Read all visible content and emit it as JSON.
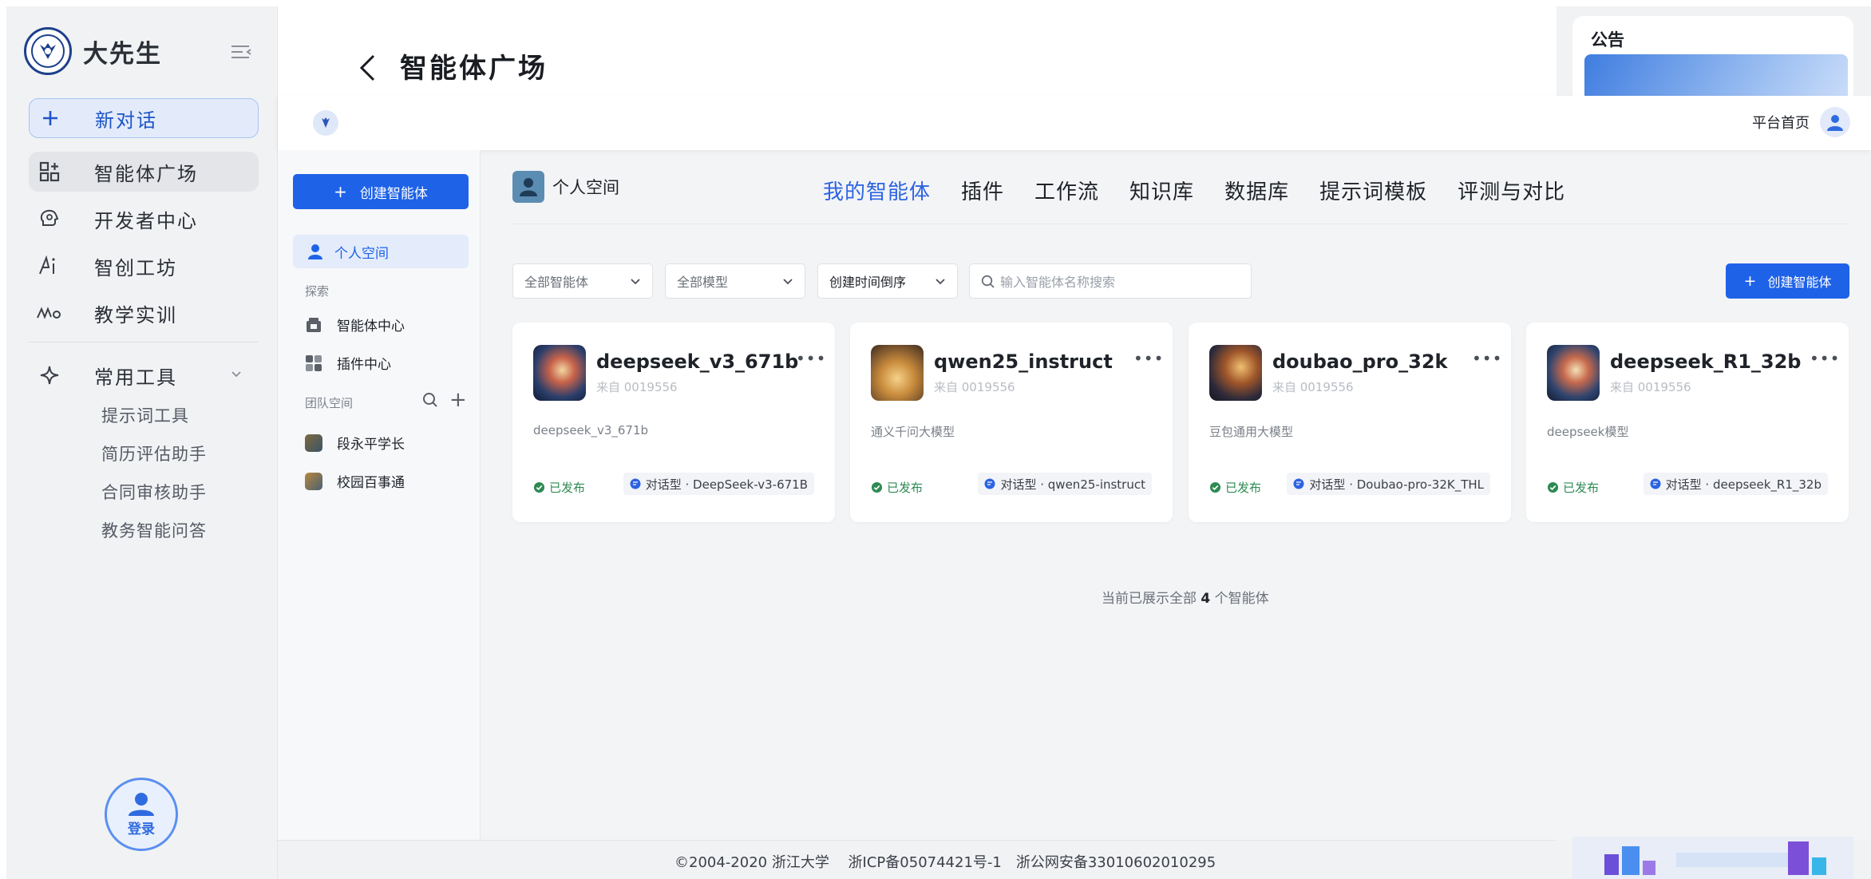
{
  "sidebar": {
    "brand": "大先生",
    "new_chat": "新对话",
    "items": [
      {
        "label": "智能体广场"
      },
      {
        "label": "开发者中心"
      },
      {
        "label": "智创工坊"
      },
      {
        "label": "教学实训"
      }
    ],
    "tools": {
      "label": "常用工具",
      "items": [
        "提示词工具",
        "简历评估助手",
        "合同审核助手",
        "教务智能问答"
      ]
    },
    "login": "登录"
  },
  "header": {
    "title": "智能体广场"
  },
  "notice": {
    "title": "公告"
  },
  "app": {
    "topbar": {
      "home_link": "平台首页"
    },
    "subnav": {
      "create_button": "创建智能体",
      "personal_space": "个人空间",
      "explore_label": "探索",
      "explore_items": [
        "智能体中心",
        "插件中心"
      ],
      "team_label": "团队空间",
      "team_items": [
        "段永平学长",
        "校园百事通"
      ]
    },
    "main": {
      "space_name": "个人空间",
      "tabs": [
        "我的智能体",
        "插件",
        "工作流",
        "知识库",
        "数据库",
        "提示词模板",
        "评测与对比"
      ],
      "active_tab": "我的智能体",
      "filters": {
        "agent_type": "全部智能体",
        "model": "全部模型",
        "sort": "创建时间倒序",
        "search_placeholder": "输入智能体名称搜索"
      },
      "create_button": "创建智能体",
      "cards": [
        {
          "name": "deepseek_v3_671b",
          "from": "来自 0019556",
          "desc": "deepseek_v3_671b",
          "status": "已发布",
          "model": "对话型 · DeepSeek-v3-671B"
        },
        {
          "name": "qwen25_instruct",
          "from": "来自 0019556",
          "desc": "通义千问大模型",
          "status": "已发布",
          "model": "对话型 · qwen25-instruct"
        },
        {
          "name": "doubao_pro_32k",
          "from": "来自 0019556",
          "desc": "豆包通用大模型",
          "status": "已发布",
          "model": "对话型 · Doubao-pro-32K_THL"
        },
        {
          "name": "deepseek_R1_32b",
          "from": "来自 0019556",
          "desc": "deepseek模型",
          "status": "已发布",
          "model": "对话型 · deepseek_R1_32b"
        }
      ],
      "count": {
        "prefix": "当前已展示全部",
        "number": "4",
        "suffix": "个智能体"
      }
    }
  },
  "footer": {
    "text": "©2004-2020 浙江大学　 浙ICP备05074421号-1　浙公网安备33010602010295"
  },
  "colors": {
    "accent": "#1e62e8",
    "active_tab": "#2d63e2",
    "published": "#2e8a53"
  }
}
